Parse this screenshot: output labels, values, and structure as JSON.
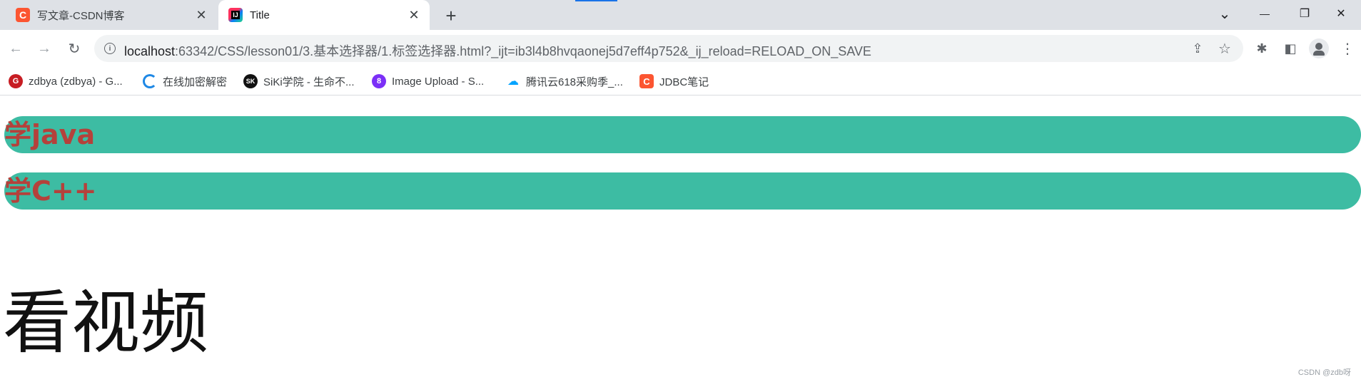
{
  "tabs": [
    {
      "title": "写文章-CSDN博客",
      "icon": "csdn-icon",
      "icon_glyph": "C",
      "close": "✕"
    },
    {
      "title": "Title",
      "icon": "intellij-icon",
      "icon_glyph": "IJ",
      "close": "✕"
    }
  ],
  "tabstrip": {
    "new_tab": "+",
    "search_tabs": "⌄",
    "minimize": "—",
    "restore": "❐",
    "close": "✕"
  },
  "toolbar": {
    "back": "←",
    "forward": "→",
    "reload": "↻",
    "url_host": "localhost",
    "url_rest": ":63342/CSS/lesson01/3.基本选择器/1.标签选择器.html?_ijt=ib3l4b8hvqaonej5d7eff4p752&_ij_reload=RELOAD_ON_SAVE",
    "info": "i",
    "share": "⇪",
    "star": "☆",
    "extensions": "✱",
    "sidepanel": "◧",
    "menu": "⋮"
  },
  "bookmarks": [
    {
      "label": "zdbya (zdbya) - G...",
      "icon": "gitee-icon",
      "glyph": "G"
    },
    {
      "label": "在线加密解密",
      "icon": "c-logo-icon",
      "glyph": ""
    },
    {
      "label": "SiKi学院 - 生命不...",
      "icon": "siki-icon",
      "glyph": "SK"
    },
    {
      "label": "Image Upload - S...",
      "icon": "image-upload-icon",
      "glyph": "8"
    },
    {
      "label": "腾讯云618采购季_...",
      "icon": "tencent-cloud-icon",
      "glyph": "☁"
    },
    {
      "label": "JDBC笔记",
      "icon": "csdn-icon",
      "glyph": "C"
    }
  ],
  "page": {
    "bar1_text": "学java",
    "bar2_text": "学C++",
    "big_text": "看视频",
    "watermark": "CSDN @zdb呀"
  },
  "colors": {
    "bar_bg": "#3dbca3",
    "bar_text": "#b5413b",
    "csdn": "#fc5531",
    "tabstrip": "#dee1e6"
  }
}
